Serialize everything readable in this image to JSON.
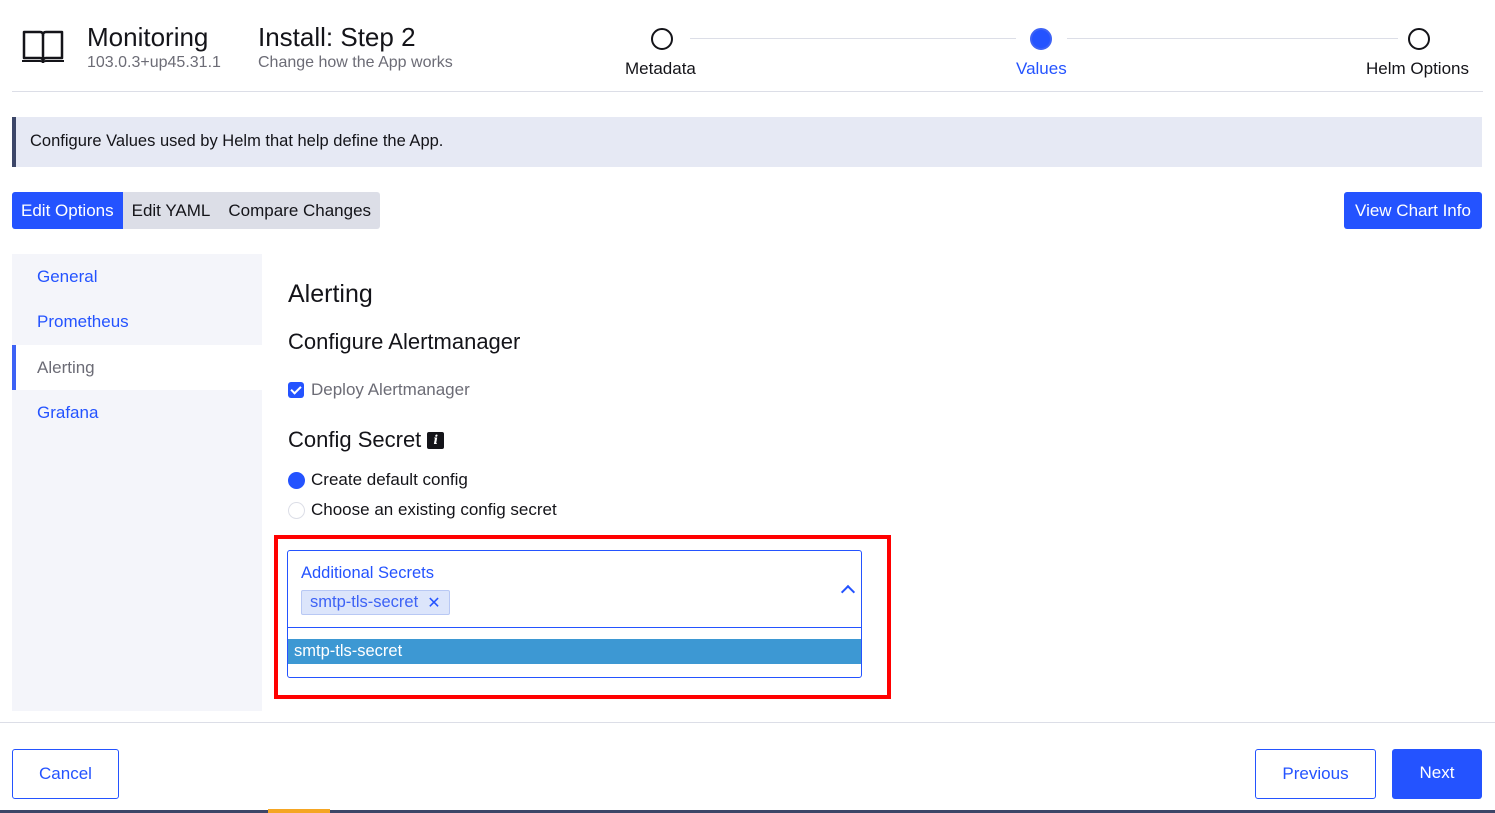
{
  "header": {
    "app_title": "Monitoring",
    "app_version": "103.0.3+up45.31.1",
    "step_title": "Install: Step 2",
    "step_subtitle": "Change how the App works",
    "steps": [
      {
        "label": "Metadata",
        "active": false
      },
      {
        "label": "Values",
        "active": true
      },
      {
        "label": "Helm Options",
        "active": false
      }
    ]
  },
  "banner": {
    "text": "Configure Values used by Helm that help define the App."
  },
  "tabs": [
    {
      "label": "Edit Options",
      "active": true
    },
    {
      "label": "Edit YAML",
      "active": false
    },
    {
      "label": "Compare Changes",
      "active": false
    }
  ],
  "view_chart_info_label": "View Chart Info",
  "sidebar": {
    "items": [
      {
        "label": "General",
        "active": false
      },
      {
        "label": "Prometheus",
        "active": false
      },
      {
        "label": "Alerting",
        "active": true
      },
      {
        "label": "Grafana",
        "active": false
      }
    ]
  },
  "content": {
    "title": "Alerting",
    "subtitle": "Configure Alertmanager",
    "deploy_checkbox": {
      "label": "Deploy Alertmanager",
      "checked": true
    },
    "config_secret_title": "Config Secret",
    "info_glyph": "i",
    "radios": [
      {
        "label": "Create default config",
        "checked": true
      },
      {
        "label": "Choose an existing config secret",
        "checked": false
      }
    ],
    "additional_secrets": {
      "label": "Additional Secrets",
      "selected_tags": [
        "smtp-tls-secret"
      ],
      "tag_remove_glyph": "✕",
      "options": [
        "smtp-tls-secret"
      ]
    }
  },
  "footer": {
    "cancel_label": "Cancel",
    "previous_label": "Previous",
    "next_label": "Next"
  },
  "colors": {
    "primary": "#2453ff",
    "highlight": "#ff0000",
    "option_highlight": "#3d98d3"
  }
}
